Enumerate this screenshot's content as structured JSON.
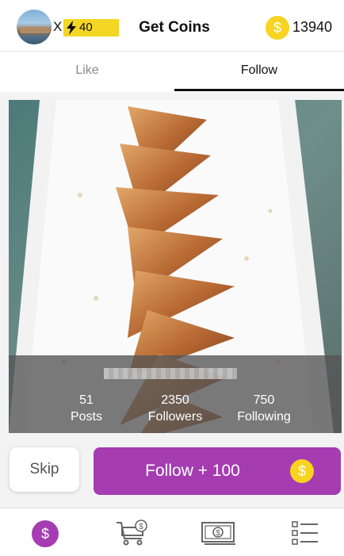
{
  "header": {
    "multiplier_label": "X",
    "energy_value": "40",
    "title": "Get Coins",
    "coin_symbol": "$",
    "coin_balance": "13940"
  },
  "tabs": [
    {
      "label": "Like",
      "active": false
    },
    {
      "label": "Follow",
      "active": true
    }
  ],
  "profile": {
    "posts_value": "51",
    "posts_label": "Posts",
    "followers_value": "2350",
    "followers_label": "Followers",
    "following_value": "750",
    "following_label": "Following"
  },
  "actions": {
    "skip_label": "Skip",
    "follow_label": "Follow + 100",
    "coin_symbol": "$"
  },
  "bottom_nav": {
    "coins_symbol": "$",
    "items": [
      "coins-icon",
      "shopping-cart-icon",
      "banknote-icon",
      "list-icon"
    ]
  },
  "colors": {
    "accent": "#a53cb2",
    "coin": "#f8d320",
    "energy": "#f4d625"
  }
}
